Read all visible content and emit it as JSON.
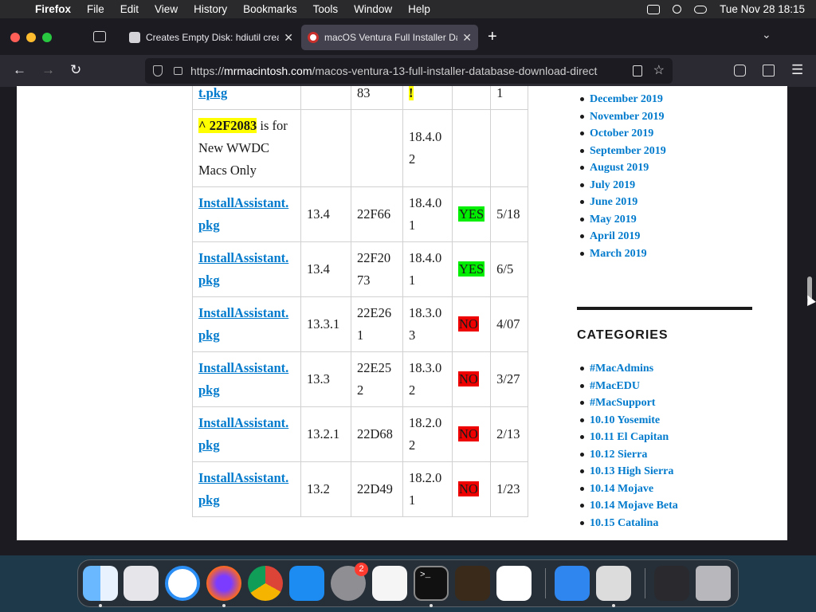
{
  "menubar": {
    "app_name": "Firefox",
    "items": [
      "File",
      "Edit",
      "View",
      "History",
      "Bookmarks",
      "Tools",
      "Window",
      "Help"
    ],
    "datetime": "Tue Nov 28  18:15"
  },
  "tabs": [
    {
      "title": "Creates Empty Disk: hdiutil create",
      "active": false
    },
    {
      "title": "macOS Ventura Full Installer Data",
      "active": true
    }
  ],
  "navbar": {
    "url_prefix": "https://",
    "url_domain": "mrmacintosh.com",
    "url_path": "/macos-ventura-13-full-installer-database-download-direct"
  },
  "table": {
    "top_row": {
      "link": "t.pkg",
      "col3": "83",
      "col4": "!",
      "col6": "1"
    },
    "note_row": {
      "caret_build": "^ 22F2083",
      "note": " is for New WWDC Macs Only",
      "safari": "18.4.0 2"
    },
    "rows": [
      {
        "link": "InstallAssistant.pkg",
        "version": "13.4",
        "build": "22F66",
        "safari": "18.4.01",
        "status": "YES",
        "date": "5/18"
      },
      {
        "link": "InstallAssistant.pkg",
        "version": "13.4",
        "build": "22F2073",
        "safari": "18.4.01",
        "status": "YES",
        "date": "6/5"
      },
      {
        "link": "InstallAssistant.pkg",
        "version": "13.3.1",
        "build": "22E261",
        "safari": "18.3.03",
        "status": "NO",
        "date": "4/07"
      },
      {
        "link": "InstallAssistant.pkg",
        "version": "13.3",
        "build": "22E252",
        "safari": "18.3.02",
        "status": "NO",
        "date": "3/27"
      },
      {
        "link": "InstallAssistant.pkg",
        "version": "13.2.1",
        "build": "22D68",
        "safari": "18.2.02",
        "status": "NO",
        "date": "2/13"
      },
      {
        "link": "InstallAssistant.pkg",
        "version": "13.2",
        "build": "22D49",
        "safari": "18.2.01",
        "status": "NO",
        "date": "1/23"
      }
    ]
  },
  "sidebar": {
    "archives": [
      "December 2019",
      "November 2019",
      "October 2019",
      "September 2019",
      "August 2019",
      "July 2019",
      "June 2019",
      "May 2019",
      "April 2019",
      "March 2019"
    ],
    "categories_title": "CATEGORIES",
    "categories": [
      "#MacAdmins",
      "#MacEDU",
      "#MacSupport",
      "10.10 Yosemite",
      "10.11 El Capitan",
      "10.12 Sierra",
      "10.13 High Sierra",
      "10.14 Mojave",
      "10.14 Mojave Beta",
      "10.15 Catalina"
    ]
  },
  "dock": {
    "settings_badge": "2",
    "terminal_prompt": ">_"
  },
  "colors": {
    "link": "#007acc",
    "yes_badge": "#00ee00",
    "no_badge": "#ee0000",
    "highlight": "#ffff00"
  }
}
